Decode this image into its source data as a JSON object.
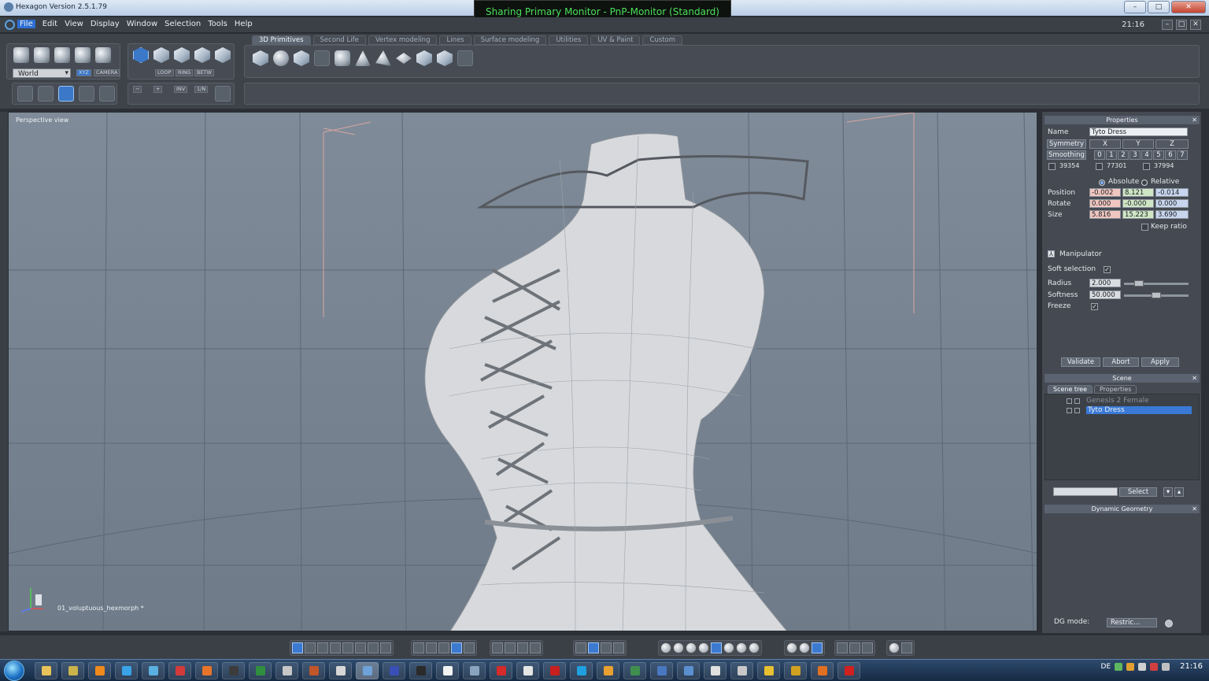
{
  "window": {
    "title": "Hexagon Version 2.5.1.79"
  },
  "sharing_banner": "Sharing Primary Monitor - PnP-Monitor (Standard)",
  "menu": {
    "items": [
      "File",
      "Edit",
      "View",
      "Display",
      "Window",
      "Selection",
      "Tools",
      "Help"
    ],
    "clock": "21:16"
  },
  "toolbar": {
    "coord_system": "World",
    "mini_labels": [
      "XYZ",
      "CAMERA",
      "LOOP",
      "RING",
      "BETW",
      "INV",
      "1/N"
    ],
    "tabs": [
      "3D Primitives",
      "Second Life",
      "Vertex modeling",
      "Lines",
      "Surface modeling",
      "Utilities",
      "UV & Paint",
      "Custom"
    ],
    "active_tab": "3D Primitives"
  },
  "viewport": {
    "label": "Perspective view",
    "object_name": "01_voluptuous_hexmorph *"
  },
  "properties": {
    "header": "Properties",
    "name_label": "Name",
    "name_value": "Tyto Dress",
    "symmetry_label": "Symmetry",
    "axes": [
      "X",
      "Y",
      "Z"
    ],
    "smoothing_label": "Smoothing",
    "smoothing_levels": [
      "0",
      "1",
      "2",
      "3",
      "4",
      "5",
      "6",
      "7"
    ],
    "counts": [
      "39354",
      "77301",
      "37994"
    ],
    "absolute_label": "Absolute",
    "relative_label": "Relative",
    "position_label": "Position",
    "position": [
      "-0.002",
      "8.121",
      "-0.014"
    ],
    "rotate_label": "Rotate",
    "rotate": [
      "0.000",
      "-0.000",
      "0.000"
    ],
    "size_label": "Size",
    "size": [
      "5.816",
      "15.223",
      "3.690"
    ],
    "keep_ratio_label": "Keep ratio",
    "manipulator_label": "Manipulator",
    "soft_selection_label": "Soft selection",
    "radius_label": "Radius",
    "radius": "2.000",
    "radius_level": 0.18,
    "softness_label": "Softness",
    "softness": "50.000",
    "softness_level": 0.5,
    "freeze_label": "Freeze",
    "validate_label": "Validate",
    "abort_label": "Abort",
    "apply_label": "Apply"
  },
  "scene": {
    "header": "Scene",
    "tabs": [
      "Scene tree",
      "Properties"
    ],
    "items": [
      "Genesis 2 Female",
      "Tyto Dress"
    ],
    "selected_item": "Tyto Dress",
    "select_label": "Select"
  },
  "dynamic_geometry": {
    "header": "Dynamic Geometry",
    "dg_mode_label": "DG mode:",
    "dg_mode_value": "Restric..."
  },
  "taskbar": {
    "language": "DE",
    "clock": "21:16"
  },
  "colors": {
    "accent": "#2e6fd3",
    "selection": "#3a7ad6",
    "share_text": "#4be05a"
  }
}
